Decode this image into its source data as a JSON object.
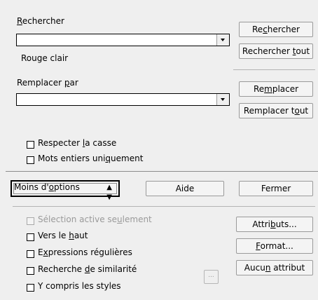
{
  "search": {
    "label_pre": "",
    "label_u": "R",
    "label_post": "echercher",
    "value": "",
    "attribute_text": "Rouge clair"
  },
  "replace": {
    "label_pre": "Remplacer ",
    "label_u": "p",
    "label_post": "ar",
    "value": ""
  },
  "buttons": {
    "search": {
      "pre": "Re",
      "u": "c",
      "post": "hercher"
    },
    "search_all": {
      "pre": "Rechercher ",
      "u": "t",
      "post": "out"
    },
    "replace": {
      "pre": "Re",
      "u": "m",
      "post": "placer"
    },
    "replace_all": {
      "pre": "Remplacer t",
      "u": "o",
      "post": "ut"
    },
    "fewer_options": {
      "pre": "Moins d'",
      "u": "o",
      "post": "ptions"
    },
    "help": "Aide",
    "close": "Fermer",
    "attributes": {
      "pre": "Attri",
      "u": "b",
      "post": "uts..."
    },
    "format": {
      "pre": "",
      "u": "F",
      "post": "ormat..."
    },
    "no_attribute": {
      "pre": "Aucu",
      "u": "n",
      "post": " attribut"
    },
    "similarity_dots": "..."
  },
  "options": {
    "match_case": {
      "pre": "Respecter ",
      "u": "l",
      "post": "a casse",
      "checked": false
    },
    "whole_words": {
      "pre": "Mots entiers uni",
      "u": "q",
      "post": "uement",
      "checked": false
    },
    "selection_only": {
      "pre": "Sélection active se",
      "u": "u",
      "post": "lement",
      "checked": false
    },
    "backwards": {
      "pre": "Vers le ",
      "u": "h",
      "post": "aut",
      "checked": false
    },
    "regex": {
      "pre": "E",
      "u": "x",
      "post": "pressions régulières",
      "checked": false
    },
    "similarity": {
      "pre": "Recherche ",
      "u": "d",
      "post": "e similarité",
      "checked": false
    },
    "styles": {
      "pre": "Y compris les styles",
      "u": "",
      "post": "",
      "checked": false
    }
  }
}
